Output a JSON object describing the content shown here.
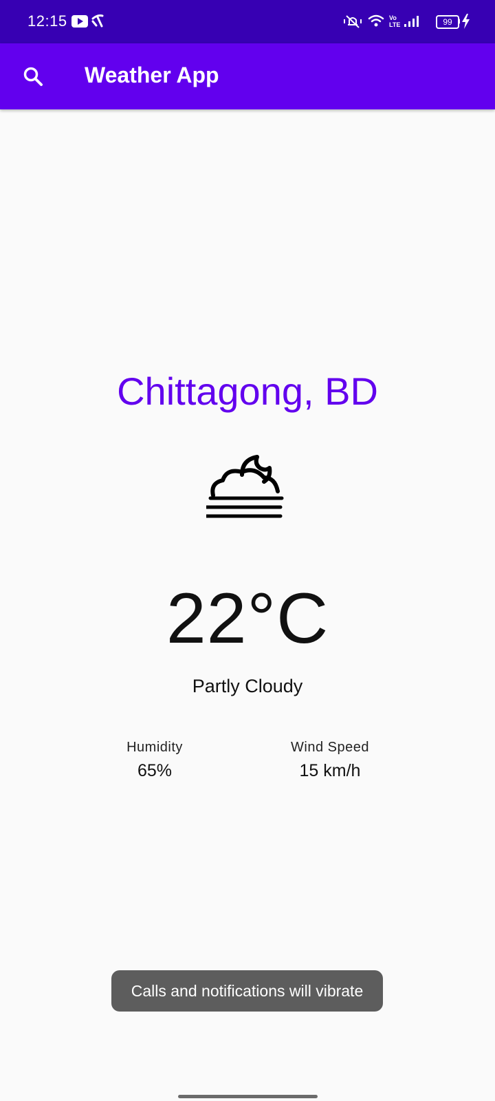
{
  "status_bar": {
    "time": "12:15",
    "battery_level": "99",
    "icons": [
      "youtube-icon",
      "carrier-icon",
      "vibrate-icon",
      "wifi-icon",
      "volte-icon",
      "signal-icon",
      "battery-icon",
      "charging-icon"
    ],
    "volte_text": "Vo LTE"
  },
  "app_bar": {
    "title": "Weather App",
    "search_icon": "search-icon"
  },
  "weather": {
    "city": "Chittagong, BD",
    "icon": "partly-cloudy-fog-icon",
    "temperature": "22°C",
    "condition": "Partly Cloudy",
    "humidity_label": "Humidity",
    "humidity_value": "65%",
    "wind_label": "Wind Speed",
    "wind_value": "15 km/h"
  },
  "toast": {
    "message": "Calls and notifications will vibrate"
  },
  "colors": {
    "status_bar": "#3700b3",
    "app_bar": "#6200ee",
    "city_text": "#6200ee",
    "background": "#fafafa",
    "toast": "#5d5d5d"
  }
}
